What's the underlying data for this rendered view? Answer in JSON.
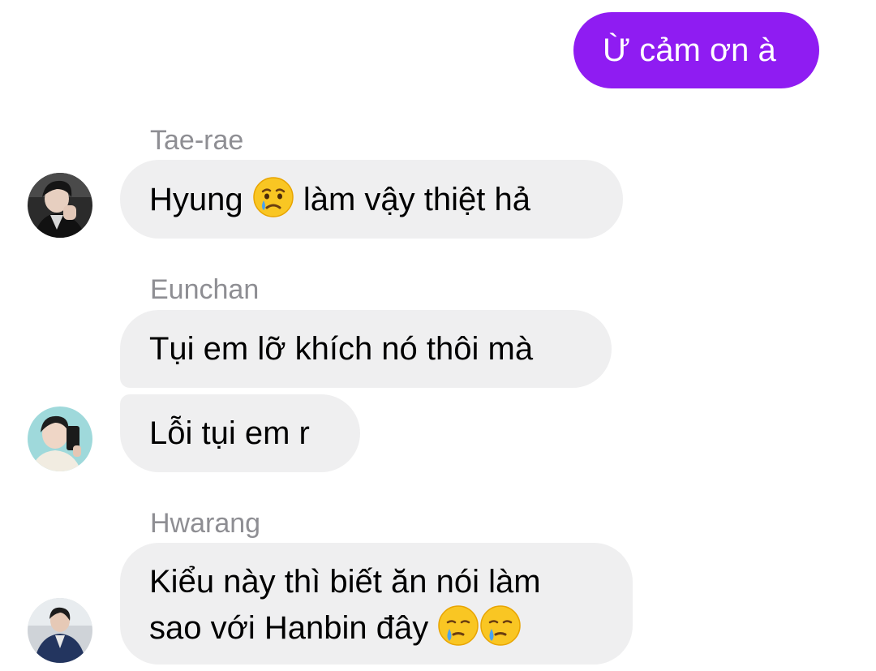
{
  "outgoing": {
    "text": "Ừ cảm ơn à",
    "color": "#8f1cf2"
  },
  "messages": [
    {
      "sender": "Tae-rae",
      "bubbles": [
        {
          "parts": [
            "Hyung ",
            "crying-face-emoji",
            " làm vậy thiệt hả"
          ]
        }
      ]
    },
    {
      "sender": "Eunchan",
      "bubbles": [
        {
          "text": "Tụi em lỡ khích nó thôi mà"
        },
        {
          "text": "Lỗi tụi em r"
        }
      ]
    },
    {
      "sender": "Hwarang",
      "bubbles": [
        {
          "lines": [
            "Kiểu này thì biết ăn nói làm",
            "sao với Hanbin đây"
          ],
          "emojis": [
            "smiling-face-with-tear-emoji",
            "smiling-face-with-tear-emoji"
          ]
        }
      ]
    }
  ],
  "colors": {
    "incoming_bubble": "#efeff0",
    "sender_name": "#8e8e93"
  }
}
